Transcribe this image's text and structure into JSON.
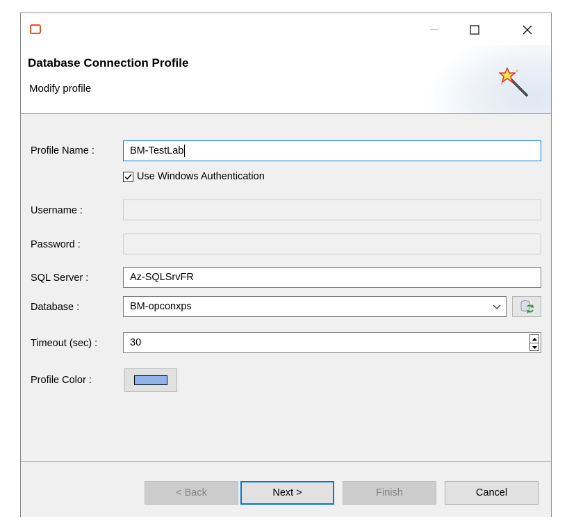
{
  "window": {
    "app_icon": "app-frame-icon",
    "minimize_glyph": "—",
    "maximize_glyph": "☐",
    "close_glyph": "✕"
  },
  "header": {
    "title": "Database Connection Profile",
    "subtitle": "Modify profile",
    "icon": "magic-wand-icon"
  },
  "form": {
    "profile_name": {
      "label": "Profile Name :",
      "value": "BM-TestLab"
    },
    "use_windows_auth": {
      "label": "Use Windows Authentication",
      "checked": true
    },
    "username": {
      "label": "Username :",
      "value": ""
    },
    "password": {
      "label": "Password :",
      "value": ""
    },
    "sql_server": {
      "label": "SQL Server :",
      "value": "Az-SQLSrvFR"
    },
    "database": {
      "label": "Database :",
      "value": "BM-opconxps",
      "refresh_icon": "refresh-database-icon"
    },
    "timeout": {
      "label": "Timeout (sec) :",
      "value": "30"
    },
    "profile_color": {
      "label": "Profile Color :",
      "color": "#8fb4eb"
    }
  },
  "buttons": {
    "back": "< Back",
    "next": "Next >",
    "finish": "Finish",
    "cancel": "Cancel"
  },
  "colors": {
    "accent": "#0078d7",
    "app_icon": "#e8501e",
    "panel_bg": "#f0f0f0"
  }
}
